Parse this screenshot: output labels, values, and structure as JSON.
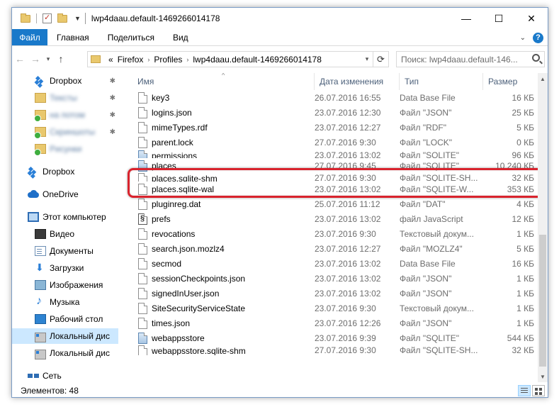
{
  "window": {
    "title": "lwp4daau.default-1469266014178",
    "minimize_glyph": "—",
    "maximize_glyph": "☐",
    "close_glyph": "✕"
  },
  "ribbon": {
    "tabs": [
      {
        "label": "Файл"
      },
      {
        "label": "Главная"
      },
      {
        "label": "Поделиться"
      },
      {
        "label": "Вид"
      }
    ],
    "accent_color": "#1979ca",
    "help_label": "?"
  },
  "address": {
    "prefix": "«",
    "crumbs": [
      "Firefox",
      "Profiles",
      "lwp4daau.default-1469266014178"
    ],
    "separator": "›",
    "refresh_glyph": "⟳",
    "search_placeholder": "Поиск: lwp4daau.default-146..."
  },
  "nav": {
    "back_glyph": "←",
    "forward_glyph": "→",
    "recent_glyph": "▾",
    "up_glyph": "↑",
    "items": [
      {
        "label": "Dropbox",
        "icon": "dropbox-icon",
        "pinned": true,
        "blurred": false
      },
      {
        "label": "Тексты",
        "icon": "folder-icon",
        "pinned": true,
        "blurred": true
      },
      {
        "label": "на потом",
        "icon": "folder-sync-icon",
        "pinned": true,
        "blurred": true
      },
      {
        "label": "Скриншоты",
        "icon": "folder-sync-icon",
        "pinned": true,
        "blurred": true
      },
      {
        "label": "Рисунки",
        "icon": "folder-sync-icon",
        "pinned": false,
        "blurred": true
      },
      {
        "label": "Dropbox",
        "icon": "dropbox-icon",
        "pinned": false,
        "blurred": false
      },
      {
        "label": "OneDrive",
        "icon": "onedrive-icon",
        "pinned": false,
        "blurred": false
      },
      {
        "label": "Этот компьютер",
        "icon": "computer-icon",
        "pinned": false,
        "blurred": false
      },
      {
        "label": "Видео",
        "icon": "video-icon",
        "pinned": false,
        "blurred": false
      },
      {
        "label": "Документы",
        "icon": "documents-icon",
        "pinned": false,
        "blurred": false
      },
      {
        "label": "Загрузки",
        "icon": "downloads-icon",
        "pinned": false,
        "blurred": false
      },
      {
        "label": "Изображения",
        "icon": "pictures-icon",
        "pinned": false,
        "blurred": false
      },
      {
        "label": "Музыка",
        "icon": "music-icon",
        "pinned": false,
        "blurred": false
      },
      {
        "label": "Рабочий стол",
        "icon": "desktop-icon",
        "pinned": false,
        "blurred": false
      },
      {
        "label": "Локальный дис",
        "icon": "disk-icon",
        "pinned": false,
        "blurred": false,
        "selected": true
      },
      {
        "label": "Локальный дис",
        "icon": "disk-icon",
        "pinned": false,
        "blurred": false
      },
      {
        "label": "Сеть",
        "icon": "network-icon",
        "pinned": false,
        "blurred": false
      }
    ],
    "pin_glyph": "✱"
  },
  "columns": {
    "name": "Имя",
    "date": "Дата изменения",
    "type": "Тип",
    "size": "Размер",
    "sort_glyph": "^"
  },
  "files": [
    {
      "name": "key3",
      "date": "26.07.2016 16:55",
      "type": "Data Base File",
      "size": "16 КБ",
      "icon": "file"
    },
    {
      "name": "logins.json",
      "date": "23.07.2016 12:30",
      "type": "Файл \"JSON\"",
      "size": "25 КБ",
      "icon": "file"
    },
    {
      "name": "mimeTypes.rdf",
      "date": "23.07.2016 12:27",
      "type": "Файл \"RDF\"",
      "size": "5 КБ",
      "icon": "file"
    },
    {
      "name": "parent.lock",
      "date": "27.07.2016 9:30",
      "type": "Файл \"LOCK\"",
      "size": "0 КБ",
      "icon": "file"
    },
    {
      "name": "permissions",
      "date": "23.07.2016 13:02",
      "type": "Файл \"SQLITE\"",
      "size": "96 КБ",
      "icon": "db",
      "clipped": true
    },
    {
      "name": "places",
      "date": "27.07.2016 9:45",
      "type": "Файл \"SQLITE\"",
      "size": "10 240 КБ",
      "icon": "db"
    },
    {
      "name": "places.sqlite-shm",
      "date": "27.07.2016 9:30",
      "type": "Файл \"SQLITE-SH...",
      "size": "32 КБ",
      "icon": "file",
      "clipped": true
    },
    {
      "name": "places.sqlite-wal",
      "date": "23.07.2016 13:02",
      "type": "Файл \"SQLITE-W...",
      "size": "353 КБ",
      "icon": "file"
    },
    {
      "name": "pluginreg.dat",
      "date": "25.07.2016 11:12",
      "type": "Файл \"DAT\"",
      "size": "4 КБ",
      "icon": "file"
    },
    {
      "name": "prefs",
      "date": "23.07.2016 13:02",
      "type": "файл JavaScript",
      "size": "12 КБ",
      "icon": "prefs"
    },
    {
      "name": "revocations",
      "date": "23.07.2016 9:30",
      "type": "Текстовый докум...",
      "size": "1 КБ",
      "icon": "file"
    },
    {
      "name": "search.json.mozlz4",
      "date": "23.07.2016 12:27",
      "type": "Файл \"MOZLZ4\"",
      "size": "5 КБ",
      "icon": "file"
    },
    {
      "name": "secmod",
      "date": "23.07.2016 13:02",
      "type": "Data Base File",
      "size": "16 КБ",
      "icon": "file"
    },
    {
      "name": "sessionCheckpoints.json",
      "date": "23.07.2016 13:02",
      "type": "Файл \"JSON\"",
      "size": "1 КБ",
      "icon": "file"
    },
    {
      "name": "signedInUser.json",
      "date": "23.07.2016 13:02",
      "type": "Файл \"JSON\"",
      "size": "1 КБ",
      "icon": "file"
    },
    {
      "name": "SiteSecurityServiceState",
      "date": "23.07.2016 9:30",
      "type": "Текстовый докум...",
      "size": "1 КБ",
      "icon": "file"
    },
    {
      "name": "times.json",
      "date": "23.07.2016 12:26",
      "type": "Файл \"JSON\"",
      "size": "1 КБ",
      "icon": "file"
    },
    {
      "name": "webappsstore",
      "date": "23.07.2016 9:39",
      "type": "Файл \"SQLITE\"",
      "size": "544 КБ",
      "icon": "db"
    },
    {
      "name": "webappsstore.sqlite-shm",
      "date": "27.07.2016 9:30",
      "type": "Файл \"SQLITE-SH...",
      "size": "32 КБ",
      "icon": "file",
      "clipped": true
    }
  ],
  "status": {
    "items_count": "Элементов: 48"
  },
  "highlight_color": "#d9232d"
}
